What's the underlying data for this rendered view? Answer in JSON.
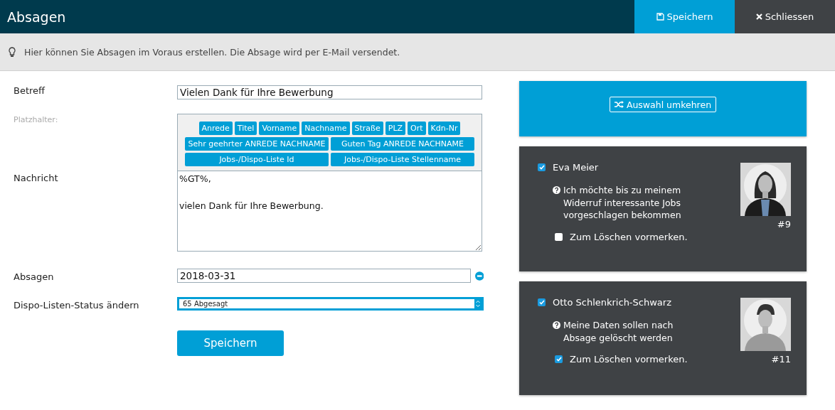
{
  "window": {
    "title": "Absagen"
  },
  "header_buttons": [
    {
      "kind": "save",
      "label": "Speichern"
    },
    {
      "kind": "close",
      "label": "Schliessen"
    }
  ],
  "info": "Hier können Sie Absagen im Voraus erstellen. Die Absage wird per E-Mail versendet.",
  "form": {
    "subject": {
      "label": "Betreff",
      "value": "Vielen Dank für Ihre Bewerbung"
    },
    "placeholders": {
      "label": "Platzhalter:",
      "buttons": [
        {
          "kind": "field",
          "label": "Anrede"
        },
        {
          "kind": "field",
          "label": "Titel"
        },
        {
          "kind": "field",
          "label": "Vorname"
        },
        {
          "kind": "field",
          "label": "Nachname"
        },
        {
          "kind": "field",
          "label": "Straße"
        },
        {
          "kind": "field",
          "label": "PLZ"
        },
        {
          "kind": "field",
          "label": "Ort"
        },
        {
          "kind": "field",
          "label": "Kdn-Nr"
        },
        {
          "kind": "greeting",
          "label": "Sehr geehrter ANREDE NACHNAME"
        },
        {
          "kind": "greeting",
          "label": "Guten Tag ANREDE NACHNAME"
        },
        {
          "kind": "list",
          "label": "Jobs-/Dispo-Liste Id"
        },
        {
          "kind": "list",
          "label": "Jobs-/Dispo-Liste Stellenname"
        }
      ]
    },
    "message": {
      "label": "Nachricht",
      "value": "%GT%,\n\nvielen Dank für Ihre Bewerbung."
    },
    "date": {
      "label": "Absagen",
      "value": "2018-03-31"
    },
    "status": {
      "label": "Dispo-Listen-Status ändern",
      "value": "65 Abgesagt"
    },
    "submit": "Speichern"
  },
  "invert_button": "Auswahl umkehren",
  "candidates": [
    {
      "name": "Eva Meier",
      "checked": true,
      "note": "Ich möchte bis zu meinem Widerruf interessante Jobs vorgeschlagen bekommen",
      "delete_label": "Zum Löschen vormerken.",
      "delete_checked": false,
      "number": "#9"
    },
    {
      "name": "Otto Schlenkrich-Schwarz",
      "checked": true,
      "note": "Meine Daten sollen nach Absage gelöscht werden",
      "delete_label": "Zum Löschen vormerken.",
      "delete_checked": true,
      "number": "#11"
    }
  ]
}
